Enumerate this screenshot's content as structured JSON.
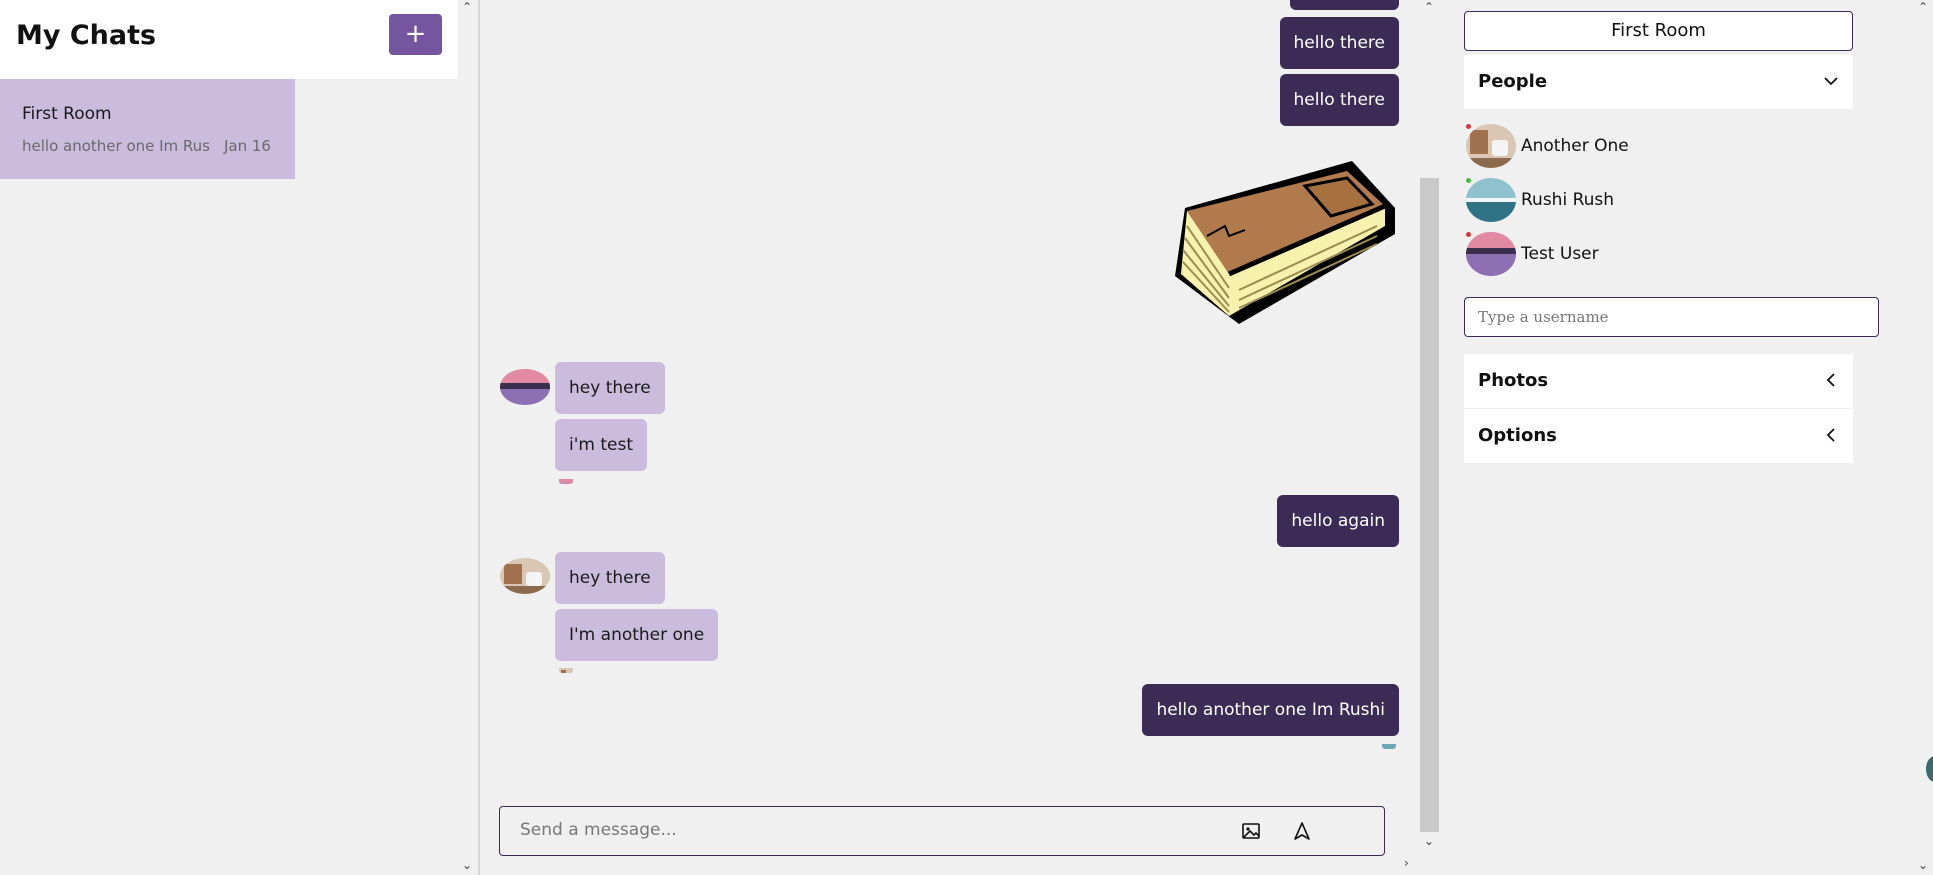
{
  "left": {
    "title": "My Chats",
    "new_chat_label": "+",
    "chats": [
      {
        "title": "First Room",
        "preview": "hello another one Im Rus",
        "date": "Jan 16"
      }
    ]
  },
  "chat": {
    "messages": [
      {
        "text": "hello there"
      },
      {
        "text": "hello there"
      },
      {
        "text": "hey there"
      },
      {
        "text": "i'm test"
      },
      {
        "text": "hello again"
      },
      {
        "text": "hey there"
      },
      {
        "text": "I'm another one"
      },
      {
        "text": "hello another one Im Rushi"
      }
    ],
    "composer_placeholder": "Send a message..."
  },
  "right": {
    "room_title": "First Room",
    "people_label": "People",
    "people": [
      {
        "name": "Another One",
        "status": "offline"
      },
      {
        "name": "Rushi Rush",
        "status": "online"
      },
      {
        "name": "Test User",
        "status": "offline"
      }
    ],
    "username_placeholder": "Type a username",
    "photos_label": "Photos",
    "options_label": "Options"
  },
  "colors": {
    "accent": "#7554a0",
    "outgoing_bubble": "#3b2b55",
    "incoming_bubble": "#cbbcdd",
    "online": "#3fbf3f",
    "offline": "#d93535"
  }
}
